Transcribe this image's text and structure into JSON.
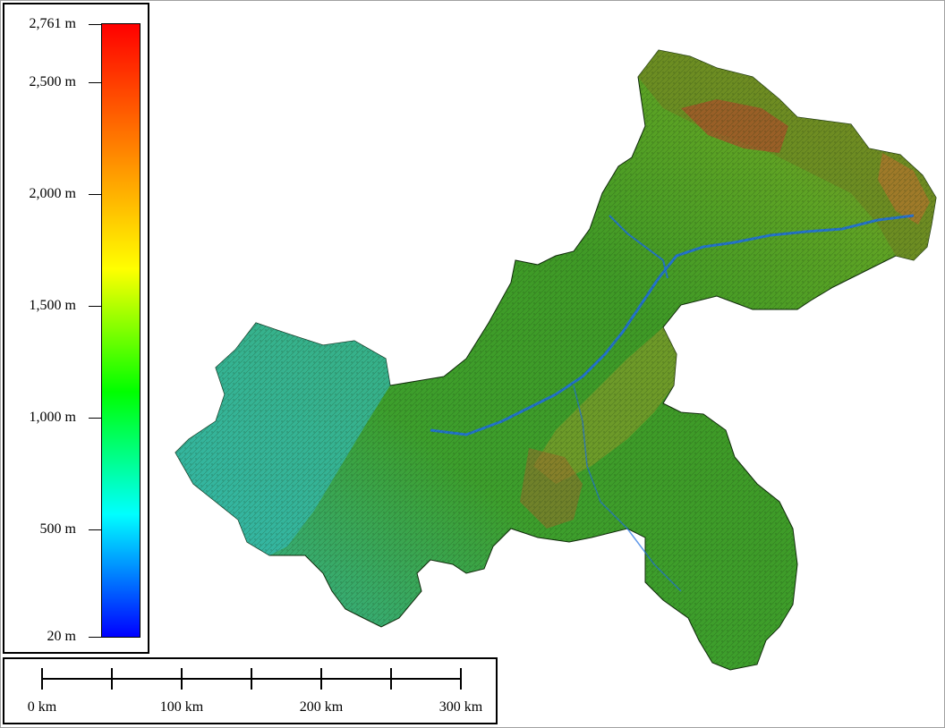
{
  "legend": {
    "unit": "m",
    "labels": [
      {
        "text": "2,761 m",
        "value": 2761
      },
      {
        "text": "2,500 m",
        "value": 2500
      },
      {
        "text": "2,000 m",
        "value": 2000
      },
      {
        "text": "1,500 m",
        "value": 1500
      },
      {
        "text": "1,000 m",
        "value": 1000
      },
      {
        "text": "500 m",
        "value": 500
      },
      {
        "text": "20 m",
        "value": 20
      }
    ],
    "min": 20,
    "max": 2761,
    "colors": [
      "#0000ff",
      "#00ffff",
      "#00ff00",
      "#ffff00",
      "#ff8000",
      "#ff0000"
    ]
  },
  "scalebar": {
    "labels": [
      {
        "text": "0 km",
        "km": 0
      },
      {
        "text": "100 km",
        "km": 100
      },
      {
        "text": "200 km",
        "km": 200
      },
      {
        "text": "300 km",
        "km": 300
      }
    ],
    "tick_interval_km": 50,
    "max_km": 300
  },
  "map": {
    "region_colors": {
      "low": "#2fb9b0",
      "mid": "#3f9a2a",
      "high_green": "#6da820",
      "upland": "#a6a030",
      "peak": "#b0542a",
      "river": "#1f6fe0"
    }
  }
}
